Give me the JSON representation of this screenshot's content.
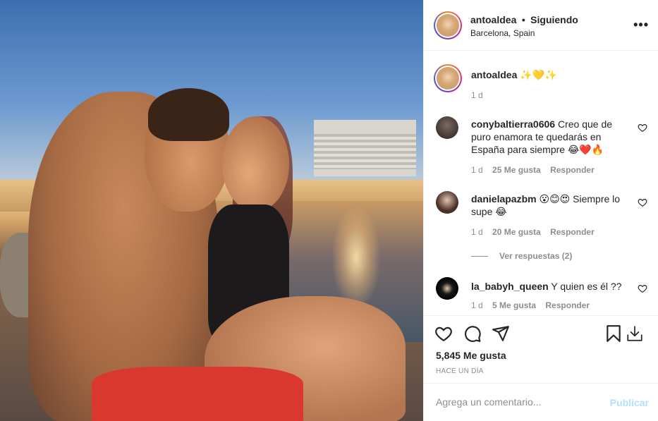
{
  "post": {
    "image_alt": "Couple sitting by the sea at sunset",
    "header": {
      "username": "antoaldea",
      "separator": "•",
      "follow_status": "Siguiendo",
      "location": "Barcelona, Spain",
      "more_icon": "more-horizontal-icon"
    },
    "caption": {
      "username": "antoaldea",
      "text": "✨💛✨",
      "age": "1 d"
    },
    "comments": [
      {
        "username": "conybaltierra0606",
        "text": "Creo que de puro enamora te quedarás en España para siempre 😂❤️🔥",
        "age": "1 d",
        "likes": "25 Me gusta",
        "reply": "Responder"
      },
      {
        "username": "danielapazbm",
        "text": "😮😊😍 Siempre lo supe 😂",
        "age": "1 d",
        "likes": "20 Me gusta",
        "reply": "Responder",
        "view_replies": "Ver respuestas (2)"
      },
      {
        "username": "la_babyh_queen",
        "text": "Y quien es él ??",
        "age": "1 d",
        "likes": "5 Me gusta",
        "reply": "Responder"
      }
    ],
    "actions": {
      "like_icon": "heart-icon",
      "comment_icon": "comment-icon",
      "share_icon": "send-icon",
      "save_icon": "bookmark-icon",
      "download_icon": "download-icon"
    },
    "likes": "5,845 Me gusta",
    "time": "HACE UN DÍA",
    "add_comment": {
      "placeholder": "Agrega un comentario...",
      "publish": "Publicar"
    }
  }
}
